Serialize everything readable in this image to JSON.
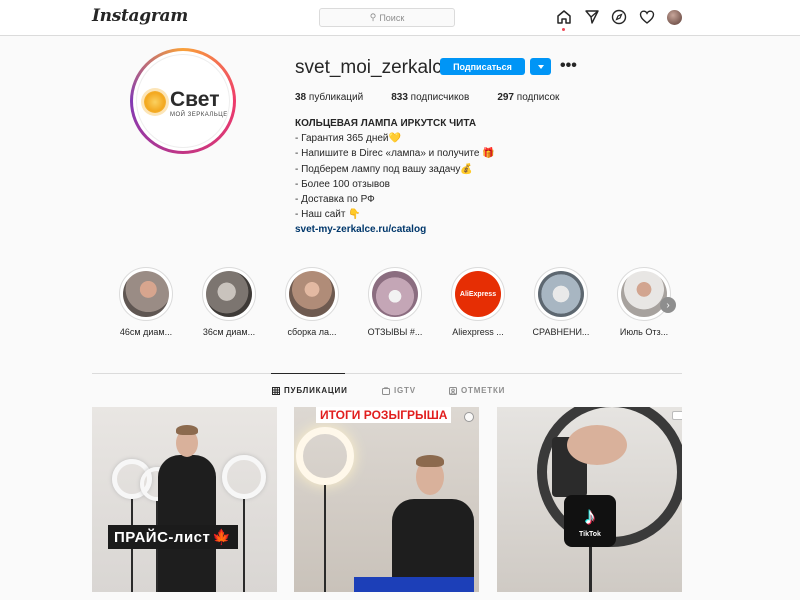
{
  "nav": {
    "logo": "Instagram",
    "search_placeholder": "Поиск",
    "icons": [
      "home-icon",
      "direct-icon",
      "explore-icon",
      "heart-icon",
      "profile-avatar"
    ]
  },
  "profile": {
    "username": "svet_moi_zerkalco",
    "avatar_brand": "Свет",
    "avatar_subtitle": "МОЙ ЗЕРКАЛЬЦЕ",
    "follow_label": "Подписаться",
    "stats": {
      "posts_count": "38",
      "posts_label": "публикаций",
      "followers_count": "833",
      "followers_label": "подписчиков",
      "following_count": "297",
      "following_label": "подписок"
    },
    "bio": {
      "title": "КОЛЬЦЕВАЯ ЛАМПА ИРКУТСК ЧИТА",
      "lines": [
        "- Гарантия 365 дней",
        "- Напишите в Direc «лампа» и получите",
        "- Подберем лампу под вашу задачу",
        "- Более 100 отзывов",
        "- Доставка по РФ",
        "- Наш сайт"
      ],
      "link": "svet-my-zerkalce.ru/catalog"
    }
  },
  "highlights": [
    {
      "label": "46см диам..."
    },
    {
      "label": "36см диам..."
    },
    {
      "label": "сборка ла..."
    },
    {
      "label": "ОТЗЫВЫ #..."
    },
    {
      "label": "Aliexpress ..."
    },
    {
      "label": "СРАВНЕНИ..."
    },
    {
      "label": "Июль Отз..."
    }
  ],
  "aliexpress_badge": "AliExpress",
  "tabs": {
    "posts": "ПУБЛИКАЦИИ",
    "igtv": "IGTV",
    "tagged": "ОТМЕТКИ"
  },
  "posts": [
    {
      "overlay": "ПРАЙС-лист"
    },
    {
      "overlay": "ИТОГИ РОЗЫГРЫША"
    },
    {
      "overlay": "TikTok"
    }
  ],
  "colors": {
    "accent": "#0095f6",
    "link": "#00376b",
    "border": "#dbdbdb"
  }
}
